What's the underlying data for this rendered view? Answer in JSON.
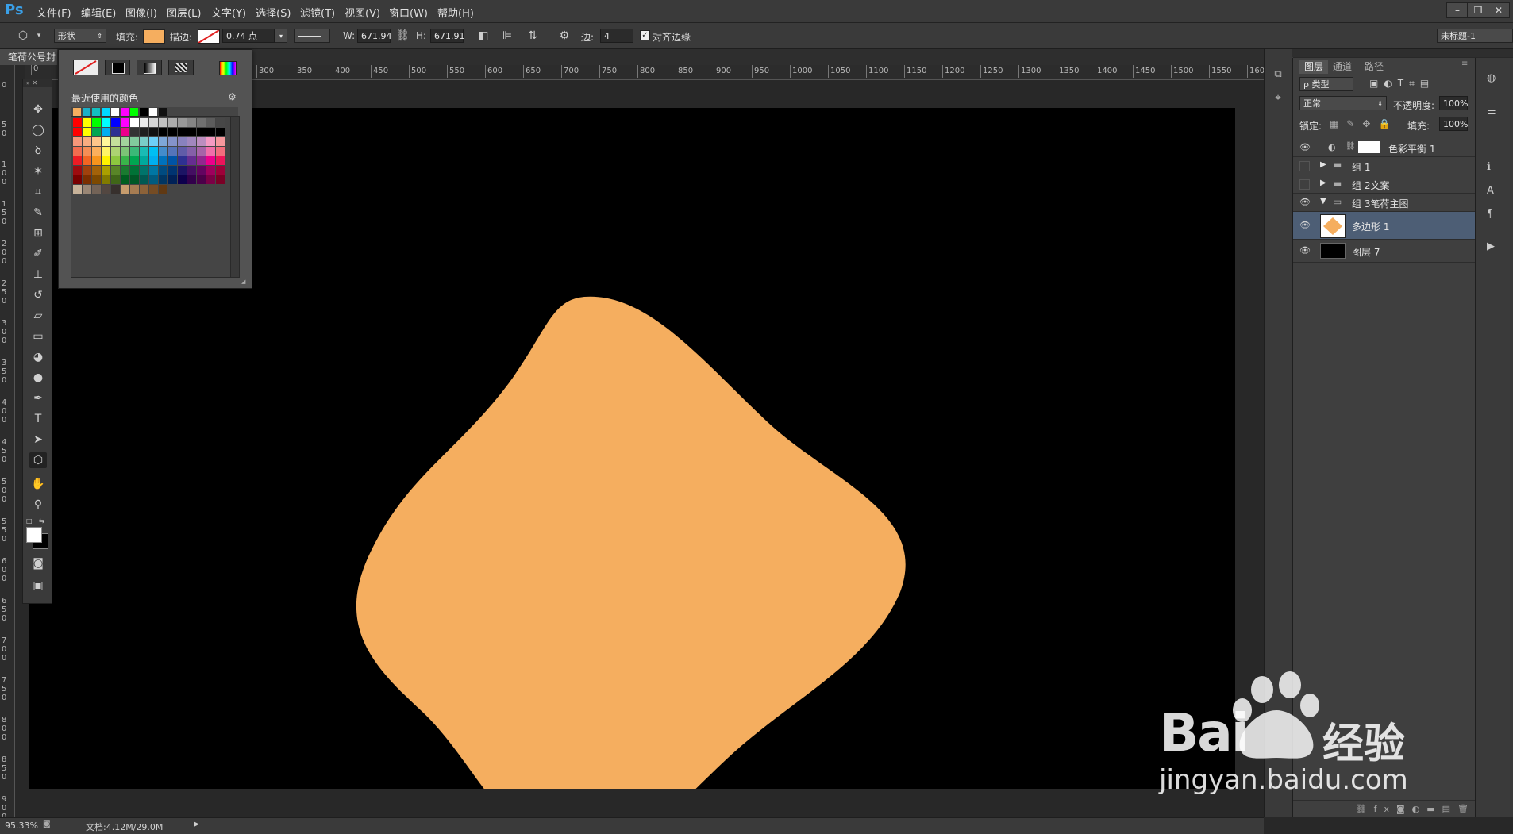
{
  "app": {
    "logo": "Ps",
    "menus": [
      "文件(F)",
      "编辑(E)",
      "图像(I)",
      "图层(L)",
      "文字(Y)",
      "选择(S)",
      "滤镜(T)",
      "视图(V)",
      "窗口(W)",
      "帮助(H)"
    ],
    "window_buttons": [
      "–",
      "❐",
      "✕"
    ]
  },
  "options_bar": {
    "tool_mode": "形状",
    "fill_label": "填充:",
    "fill_color": "#f5ae5f",
    "stroke_label": "描边:",
    "stroke_width": "0.74 点",
    "w_label": "W:",
    "w_value": "671.94",
    "h_label": "H:",
    "h_value": "671.91",
    "sides_label": "边:",
    "sides_value": "4",
    "align_edges_label": "对齐边缘",
    "align_edges_checked": true,
    "workspace": "未标题-1"
  },
  "document": {
    "tab_title": "笔荷公号封",
    "shape_color": "#f5ae5f",
    "canvas_color": "#000000"
  },
  "rulers": {
    "h_ticks": [
      "300",
      "350",
      "400",
      "450",
      "500",
      "550",
      "600",
      "650",
      "700",
      "750",
      "800",
      "850",
      "900",
      "950",
      "1000",
      "1050",
      "1100",
      "1150",
      "1200",
      "1250",
      "1300",
      "1350",
      "1400",
      "1450",
      "1500",
      "1550",
      "160"
    ],
    "h_start": "0",
    "v_ticks": [
      "0",
      "50",
      "100",
      "150",
      "200",
      "250",
      "300",
      "350",
      "400",
      "450",
      "500",
      "550",
      "600",
      "650",
      "700",
      "750",
      "800",
      "850",
      "900"
    ]
  },
  "swatch_popup": {
    "recent_label": "最近使用的颜色",
    "recent_colors": [
      "#f5ae5f",
      "#1ab0c8",
      "#12c0c0",
      "#00d8ff",
      "#ffffff",
      "#ff00ff",
      "#00ff00",
      "#000000",
      "#ffffff",
      "#111111"
    ],
    "grid_rows": [
      [
        "#ff0000",
        "#ffff00",
        "#00ff00",
        "#00ffff",
        "#0000ff",
        "#ff00ff",
        "#ffffff",
        "#ebebeb",
        "#d6d6d6",
        "#c2c2c2",
        "#adadad",
        "#999999",
        "#858585",
        "#707070",
        "#5c5c5c",
        "#474747"
      ],
      [
        "#ff0000",
        "#ffff00",
        "#00a651",
        "#00aeef",
        "#2e3192",
        "#ec008c",
        "#333333",
        "#1f1f1f",
        "#111111",
        "#000000",
        "#000000",
        "#000000",
        "#000000",
        "#000000",
        "#000000",
        "#000000"
      ],
      [
        "#f7977a",
        "#f9ad81",
        "#fdc68a",
        "#fff79a",
        "#c4df9b",
        "#a2d39c",
        "#82ca9d",
        "#7bcdc8",
        "#6ecff6",
        "#7ea7d8",
        "#8493ca",
        "#8882be",
        "#a187be",
        "#bc8dbf",
        "#f49ac2",
        "#f6989d"
      ],
      [
        "#f26c4f",
        "#f68e55",
        "#fbaf5c",
        "#fff467",
        "#acd372",
        "#7cc576",
        "#3bb878",
        "#1abbb4",
        "#00bff3",
        "#438ccb",
        "#5574b9",
        "#605ca8",
        "#855fa8",
        "#a763a8",
        "#f06ea9",
        "#f26d7d"
      ],
      [
        "#ed1c24",
        "#f26522",
        "#f7941d",
        "#fff200",
        "#8dc73f",
        "#39b54a",
        "#00a651",
        "#00a99d",
        "#00aeef",
        "#0072bc",
        "#0054a6",
        "#2e3192",
        "#662d91",
        "#92278f",
        "#ec008c",
        "#ed145b"
      ],
      [
        "#9e0b0f",
        "#a0410d",
        "#a36209",
        "#aba000",
        "#598527",
        "#1a7b30",
        "#007236",
        "#00746b",
        "#0076a3",
        "#004b80",
        "#003471",
        "#1b1464",
        "#440e62",
        "#630460",
        "#9e005d",
        "#9e0039"
      ],
      [
        "#790000",
        "#7b2e00",
        "#7d4900",
        "#827b00",
        "#406618",
        "#005e20",
        "#005826",
        "#005952",
        "#005b7f",
        "#003663",
        "#002157",
        "#0d004c",
        "#32004b",
        "#4b0049",
        "#7b0046",
        "#7a0026"
      ],
      [
        "#c7b299",
        "#998675",
        "#736357",
        "#534741",
        "#37302d",
        "#c69c6d",
        "#a67c52",
        "#8c6239",
        "#754c24",
        "#603913"
      ]
    ]
  },
  "layers_panel": {
    "tabs": [
      "图层",
      "通道",
      "路径"
    ],
    "filter_kind": "ρ 类型",
    "blend_mode": "正常",
    "opacity_label": "不透明度:",
    "opacity_value": "100%",
    "lock_label": "锁定:",
    "fill_label": "填充:",
    "fill_value": "100%",
    "layers": [
      {
        "name": "色彩平衡 1",
        "visible": true,
        "type": "adjustment"
      },
      {
        "name": "组 1",
        "visible": false,
        "type": "group"
      },
      {
        "name": "组 2文案",
        "visible": false,
        "type": "group"
      },
      {
        "name": "组 3笔荷主图",
        "visible": true,
        "type": "group-open"
      },
      {
        "name": "多边形 1",
        "visible": true,
        "type": "shape",
        "selected": true
      },
      {
        "name": "图层 7",
        "visible": true,
        "type": "pixel"
      }
    ],
    "footer_icons": [
      "link-icon",
      "fx-icon",
      "mask-icon",
      "adjustment-icon",
      "folder-icon",
      "new-layer-icon",
      "trash-icon"
    ]
  },
  "status_bar": {
    "zoom": "95.33%",
    "doc_info": "文档:4.12M/29.0M"
  },
  "watermark": {
    "brand_left": "Bai",
    "brand_right": "经验",
    "url": "jingyan.baidu.com"
  }
}
